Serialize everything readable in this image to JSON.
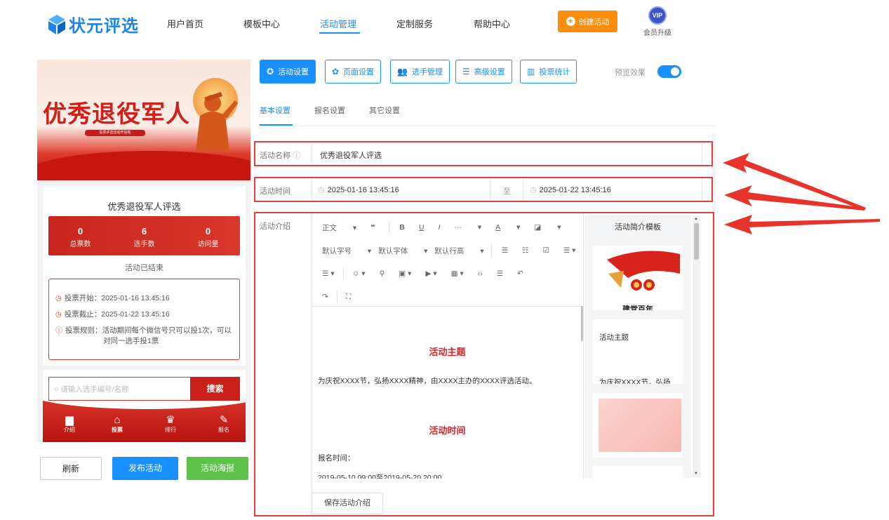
{
  "nav": {
    "logo_text": "状元评选",
    "items": [
      "用户首页",
      "模板中心",
      "活动管理",
      "定制服务",
      "帮助中心"
    ],
    "create_label": "创建活动",
    "vip_badge": "VIP",
    "vip_label": "会员升级"
  },
  "preview": {
    "banner_title": "优秀退役军人",
    "banner_sub": "投票评选活动开始啦",
    "activity_name": "优秀退役军人评选",
    "stats": [
      {
        "value": "0",
        "label": "总票数"
      },
      {
        "value": "6",
        "label": "选手数"
      },
      {
        "value": "0",
        "label": "访问量"
      }
    ],
    "status": "活动已结束",
    "vote_start": "投票开始：2025-01-16 13:45:16",
    "vote_end": "投票截止：2025-01-22 13:45:16",
    "vote_rule": "投票规则：活动期间每个微信号只可以投1次，可以",
    "vote_rule_cont": "对同一选手投1票",
    "search_placeholder": "请输入选手编号/名称",
    "search_label": "搜索",
    "tabs": [
      "介绍",
      "投票",
      "排行",
      "报名"
    ]
  },
  "actions": {
    "refresh": "刷新",
    "publish": "发布活动",
    "poster": "活动海报"
  },
  "toolbar": {
    "buttons": [
      "活动设置",
      "页面设置",
      "选手管理",
      "高级设置",
      "投票统计"
    ],
    "preview_label": "预览效果"
  },
  "subtabs": [
    "基本设置",
    "报名设置",
    "其它设置"
  ],
  "form": {
    "name_label": "活动名称",
    "name_value": "优秀退役军人评选",
    "time_label": "活动时间",
    "time_start": "2025-01-16 13:45:16",
    "time_sep": "至",
    "time_end": "2025-01-22 13:45:16",
    "intro_label": "活动介绍",
    "save_label": "保存活动介绍"
  },
  "editor": {
    "row1": [
      "正文",
      "❝",
      "B",
      "U",
      "I",
      "···",
      "A",
      "◪"
    ],
    "row2": [
      "默认字号",
      "默认字体",
      "默认行高"
    ],
    "heading1": "活动主题",
    "para1": "为庆祝XXXX节，弘扬XXXX精神，由XXXX主办的XXXX评选活动。",
    "heading2": "活动时间",
    "para2": "报名时间：",
    "para3": "2019-05-10 09:00至2019-05-20 20:00"
  },
  "templates": {
    "title": "活动简介模板",
    "card1_caption": "建党百年",
    "card2_title": "活动主题",
    "card2_text": "为庆祝XXXX节，弘扬"
  },
  "colors": {
    "primary": "#1890ff",
    "orange": "#fb8c0c",
    "red": "#d9262a",
    "green": "#5cc24a",
    "highlight": "#e04040"
  }
}
